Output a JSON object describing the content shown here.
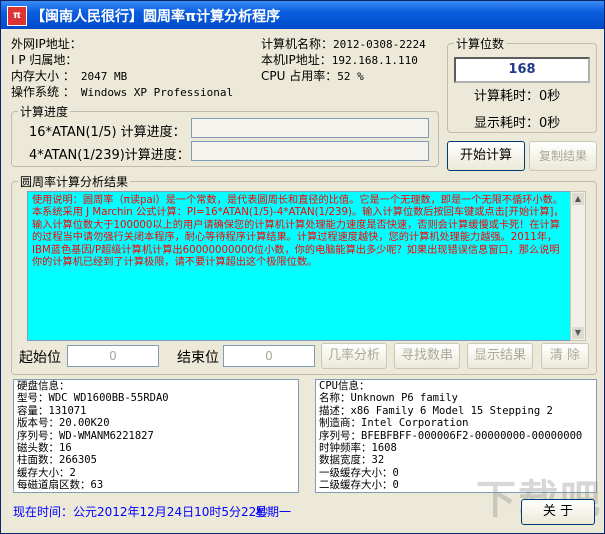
{
  "window": {
    "title": "【闽南人民很行】圆周率π计算分析程序"
  },
  "sysinfo": {
    "left": [
      {
        "label": "外网IP地址：",
        "value": ""
      },
      {
        "label": "I P 归属地：",
        "value": ""
      },
      {
        "label": "内存大小 ：",
        "value": "2047 MB"
      },
      {
        "label": "操作系统 ：",
        "value": "Windows XP Professional"
      }
    ],
    "right": [
      {
        "label": "计算机名称：",
        "value": "2012-0308-2224"
      },
      {
        "label": "本机IP地址：",
        "value": "192.168.1.110"
      },
      {
        "label": "CPU 占用率：",
        "value": "52 %"
      }
    ]
  },
  "digits": {
    "legend": "计算位数",
    "value": "168",
    "calc_time": "计算耗时：0秒",
    "display_time": "显示耗时：0秒"
  },
  "progress": {
    "legend": "计算进度",
    "row1": "16*ATAN(1/5) 计算进度：",
    "row2": "4*ATAN(1/239)计算进度："
  },
  "buttons": {
    "start": "开始计算",
    "copy": "复制结果",
    "prob": "几率分析",
    "find": "寻找数串",
    "show": "显示结果",
    "clear": "清 除",
    "about": "关 于"
  },
  "result": {
    "legend": "圆周率计算分析结果",
    "text": "    使用说明：圆周率（π读pai）是一个常数，是代表圆周长和直径的比值。它是一个无理数，即是一个无限不循环小数。本系统采用 J Marchin 公式计算：PI=16*ATAN(1/5)-4*ATAN(1/239)。输入计算位数后按回车键或点击[开始计算]，输入计算位数大于100000以上的用户请确保您的计算机计算处理能力速度是否快速，否则会计算缓慢或卡死！在计算的过程当中请勿强行关闭本程序，耐心等待程序计算结果。计算过程速度越快，您的计算机处理能力越强。2011年，IBM蓝色基因/P超级计算机计算出60000000000位小数，你的电脑能算出多少呢？如果出现错误信息窗口，那么说明你的计算机已经到了计算极限，请不要计算超出这个极限位数。"
  },
  "range": {
    "start_label": "起始位",
    "start_value": "0",
    "end_label": "结束位",
    "end_value": "0"
  },
  "disk": [
    "硬盘信息：",
    "型号：WDC WD1600BB-55RDA0",
    "容量：131071",
    "版本号：20.00K20",
    "序列号：WD-WMANM6221827",
    "磁头数：16",
    "柱面数：266305",
    "缓存大小：2",
    "每磁道扇区数：63"
  ],
  "cpu": [
    "CPU信息：",
    "名称：Unknown P6 family",
    "描述：x86 Family 6 Model 15 Stepping 2",
    "制造商：Intel Corporation",
    "序列号：BFEBFBFF-000006F2-00000000-00000000",
    "时钟频率：1608",
    "数据宽度：32",
    "一级缓存大小：0",
    "二级缓存大小：0"
  ],
  "status": {
    "time_label": "现在时间：公元2012年12月24日10时5分22秒",
    "weekday": "星期一",
    "watermark": "下载吧"
  },
  "colors": {
    "result_bg": "#00ffff",
    "result_text": "#ff0000",
    "status_text": "#0000ff"
  }
}
